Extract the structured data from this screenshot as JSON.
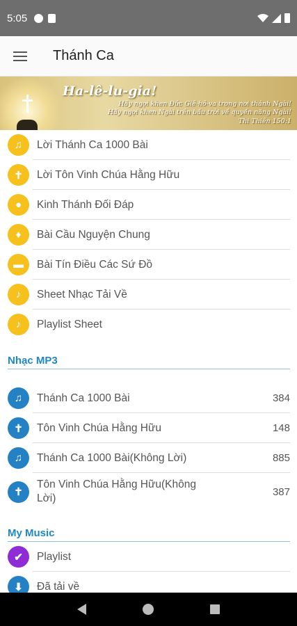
{
  "status_bar": {
    "time": "5:05"
  },
  "app_bar": {
    "title": "Thánh Ca"
  },
  "banner": {
    "title": "Ha-lê-lu-gia!",
    "line1": "Hãy ngợi khen Đức Giê-hô-va trong nơi thánh Ngài!",
    "line2": "Hãy ngợi khen Ngài trên bầu trời về quyền năng Ngài!",
    "line3": "Thi Thiên 150:1"
  },
  "menu": {
    "items": [
      {
        "label": "Lời Thánh Ca 1000 Bài",
        "icon": "hymn-book-icon"
      },
      {
        "label": "Lời Tôn Vinh Chúa Hằng Hữu",
        "icon": "worship-icon"
      },
      {
        "label": "Kinh Thánh Đối Đáp",
        "icon": "chat-bubble-icon"
      },
      {
        "label": "Bài Cầu Nguyện Chung",
        "icon": "praying-hands-icon"
      },
      {
        "label": "Bài Tín Điều Các Sứ Đồ",
        "icon": "open-book-icon"
      },
      {
        "label": "Sheet Nhạc Tải Về",
        "icon": "music-note-icon"
      },
      {
        "label": "Playlist Sheet",
        "icon": "music-note-icon"
      }
    ]
  },
  "mp3": {
    "header": "Nhạc MP3",
    "items": [
      {
        "label": "Thánh Ca 1000 Bài",
        "count": "384"
      },
      {
        "label": "Tôn Vinh Chúa Hằng Hữu",
        "count": "148"
      },
      {
        "label": "Thánh Ca 1000 Bài(Không Lời)",
        "count": "885"
      },
      {
        "label": "Tôn Vinh Chúa Hằng Hữu(Không Lời)",
        "count": "387"
      }
    ]
  },
  "my_music": {
    "header": "My Music",
    "items": [
      {
        "label": "Playlist"
      },
      {
        "label": "Đã tải về"
      }
    ]
  },
  "colors": {
    "accent_blue": "#1e88c8",
    "icon_yellow": "#f6c11c",
    "icon_blue": "#2381c4",
    "icon_purple": "#8e2cd6"
  }
}
